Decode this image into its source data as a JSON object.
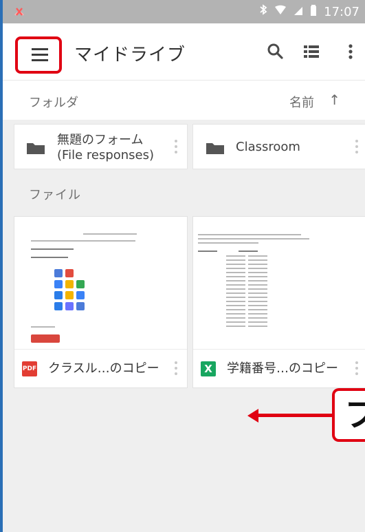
{
  "status_bar": {
    "time": "17:07",
    "left_icon": "signal-off-icon",
    "bluetooth_icon": "bluetooth-icon",
    "wifi_icon": "wifi-icon",
    "cellular_icon": "cellular-icon",
    "battery_icon": "battery-icon"
  },
  "app_bar": {
    "title": "マイドライブ",
    "menu_icon": "menu-icon",
    "search_icon": "search-icon",
    "list_icon": "list-view-icon",
    "more_icon": "more-vert-icon"
  },
  "folders_section": {
    "label": "フォルダ",
    "sort_label": "名前",
    "sort_arrow": "↑",
    "items": [
      {
        "line1": "無題のフォーム",
        "line2": "(File responses)",
        "icon": "folder-icon"
      },
      {
        "line1": "Classroom",
        "line2": "",
        "icon": "folder-icon"
      }
    ]
  },
  "files_section": {
    "label": "ファイル",
    "items": [
      {
        "name": "クラスル…のコピー",
        "type_label": "PDF",
        "type_icon": "pdf-file-icon"
      },
      {
        "name": "学籍番号…のコピー",
        "type_label": "X",
        "type_icon": "spreadsheet-file-icon"
      }
    ]
  },
  "annotation": {
    "callout_text": "フ"
  },
  "colors": {
    "status_bar": "#b3b3b3",
    "highlight_red": "#e00012",
    "frame_blue": "#2b6fb6",
    "pdf_red": "#e23d33",
    "sheet_green": "#18a660"
  }
}
